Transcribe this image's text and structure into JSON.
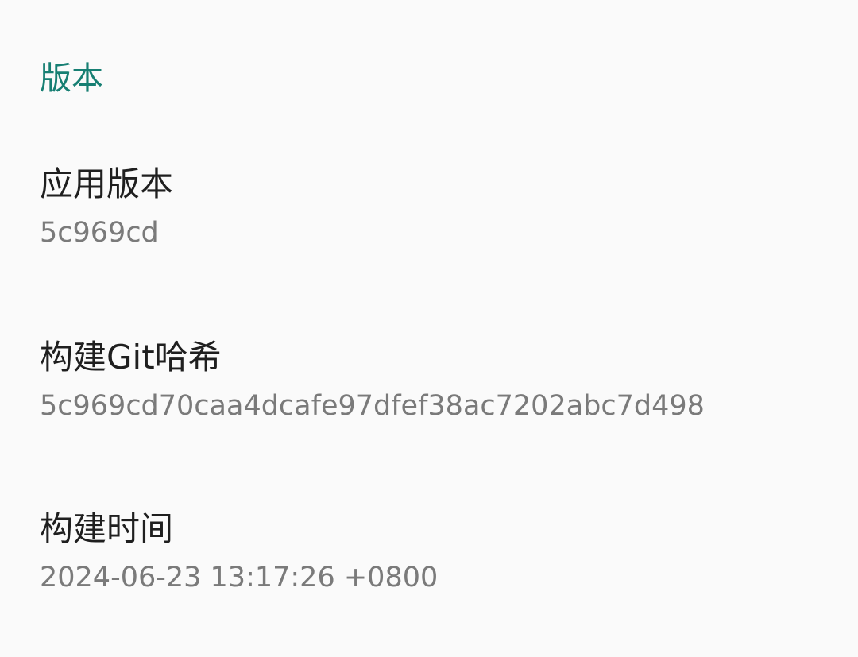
{
  "section": {
    "title": "版本"
  },
  "items": [
    {
      "title": "应用版本",
      "summary": "5c969cd"
    },
    {
      "title": "构建Git哈希",
      "summary": "5c969cd70caa4dcafe97dfef38ac7202abc7d498"
    },
    {
      "title": "构建时间",
      "summary": "2024-06-23 13:17:26 +0800"
    }
  ],
  "colors": {
    "accent": "#177f73",
    "background": "#fafafa",
    "title_text": "#1f1f1f",
    "summary_text": "#7a7a7a"
  }
}
